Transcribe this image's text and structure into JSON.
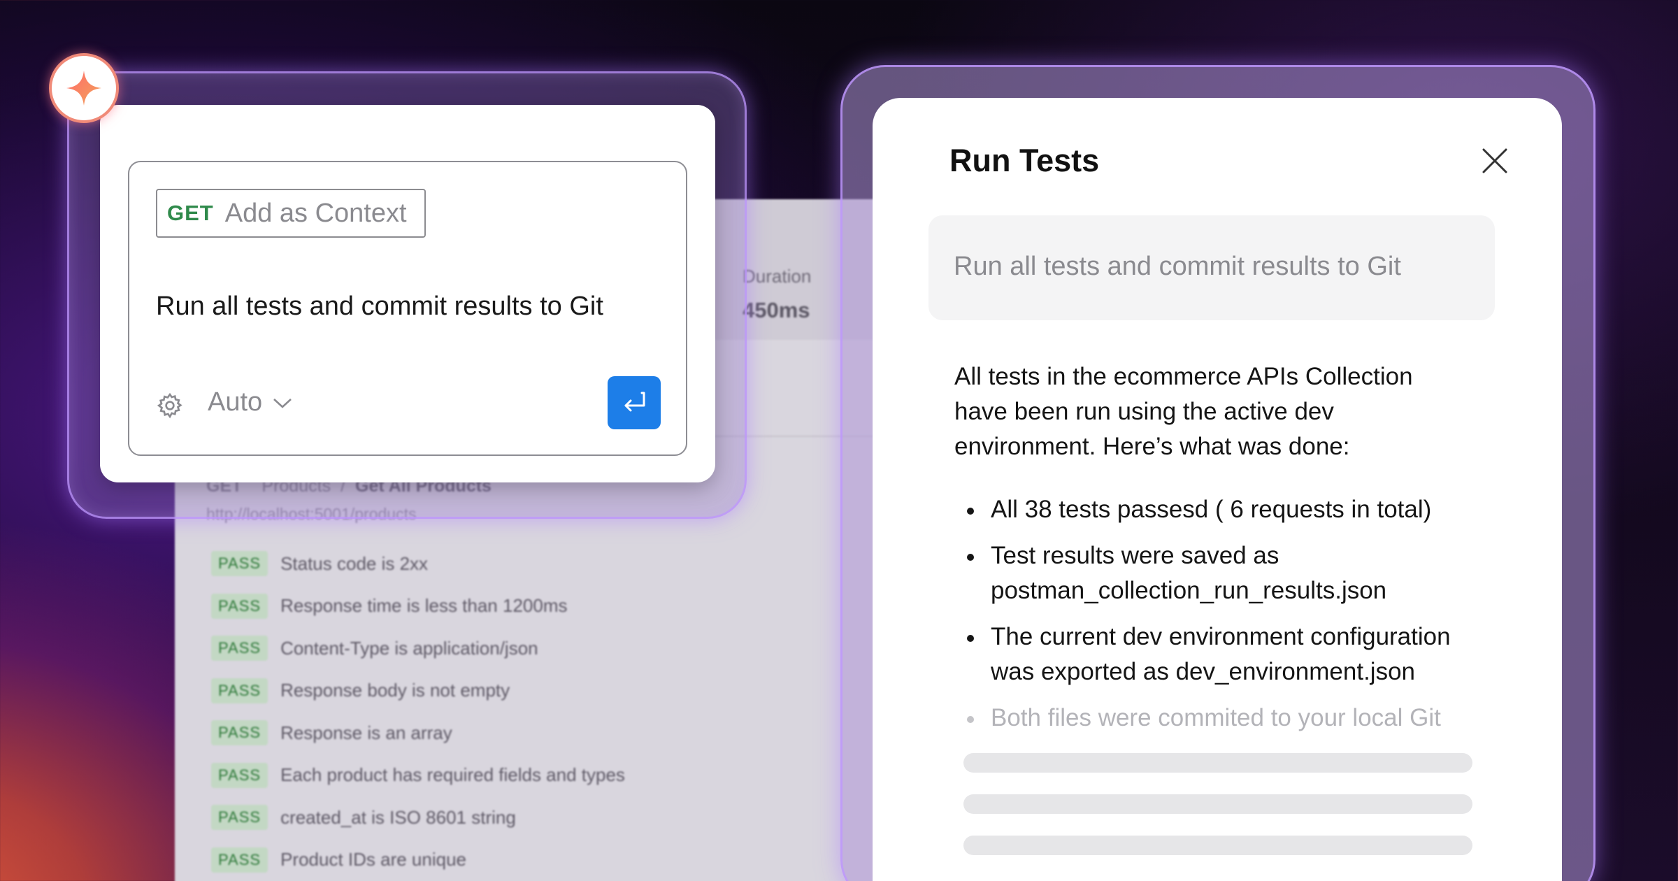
{
  "background_panel": {
    "duration_label": "Duration",
    "duration_value": "450ms",
    "request": {
      "method": "GET",
      "folder": "Products",
      "separator": "/",
      "name": "Get All Products",
      "url": "http://localhost:5001/products"
    },
    "pass_label": "PASS",
    "tests": [
      "Status code is 2xx",
      "Response time is less than 1200ms",
      "Content-Type is application/json",
      "Response body is not empty",
      "Response is an array",
      "Each product has required fields and types",
      "created_at is ISO 8601 string",
      "Product IDs are unique"
    ]
  },
  "chat": {
    "badge_icon": "sparkle-icon",
    "context_chip": {
      "method": "GET",
      "label": "Add as Context"
    },
    "prompt": "Run all tests and commit results to Git",
    "model_select": "Auto",
    "send_icon": "enter-return-icon"
  },
  "run_tests": {
    "title": "Run Tests",
    "query": "Run all tests and commit results to Git",
    "intro": "All tests in the ecommerce APIs Collection have been run using the active dev environment. Here’s what was done:",
    "bullets": [
      "All 38 tests passesd ( 6 requests in total)",
      "Test results were saved as postman_collection_run_results.json",
      "The current dev environment configuration was exported as dev_environment.json",
      "Both files were commited to your local Git"
    ]
  },
  "colors": {
    "accent_blue": "#1d7ee8",
    "method_green": "#2f8a4b",
    "glow_purple": "#be96ff",
    "badge_coral": "#f08a78"
  }
}
